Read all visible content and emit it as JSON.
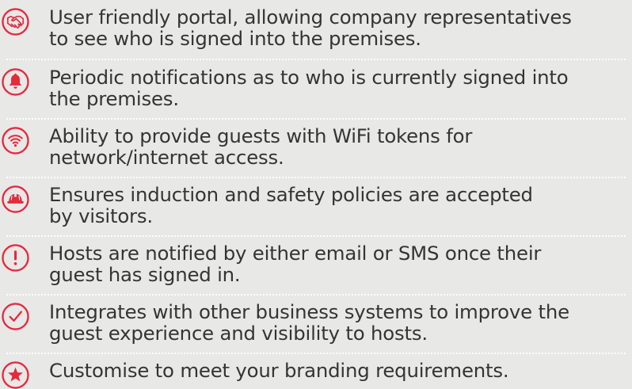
{
  "accent_color": "#e42a3d",
  "text_color": "#343434",
  "background_color": "#e8e8e7",
  "features": [
    {
      "icon": "handshake-icon",
      "line1": "User friendly portal, allowing company representatives",
      "line2": "to see who is signed into the premises."
    },
    {
      "icon": "bell-icon",
      "line1": "Periodic notifications as to who is currently signed into",
      "line2": "the premises."
    },
    {
      "icon": "wifi-icon",
      "line1": "Ability to provide guests with WiFi tokens for",
      "line2": "network/internet access."
    },
    {
      "icon": "safety-helmet-icon",
      "line1": "Ensures induction and safety policies are accepted",
      "line2": "by visitors."
    },
    {
      "icon": "exclamation-icon",
      "line1": "Hosts are notified by either email or SMS once their",
      "line2": "guest has signed in."
    },
    {
      "icon": "checkmark-icon",
      "line1": "Integrates with other business systems to improve the",
      "line2": "guest experience and visibility to hosts."
    },
    {
      "icon": "star-icon",
      "line1": "Customise to meet your branding requirements.",
      "line2": ""
    }
  ]
}
